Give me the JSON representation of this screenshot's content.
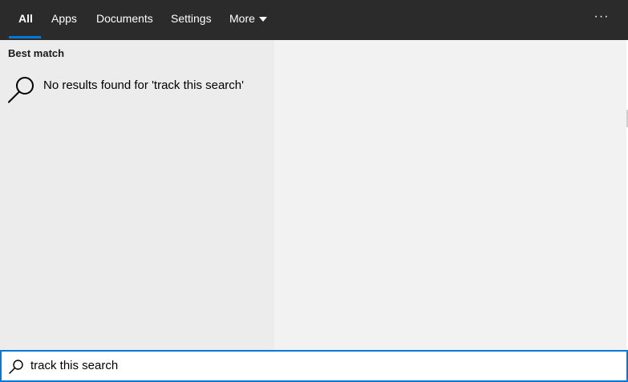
{
  "tabs": {
    "all": "All",
    "apps": "Apps",
    "documents": "Documents",
    "settings": "Settings",
    "more": "More"
  },
  "active_tab": "All",
  "overflow_menu": "···",
  "results": {
    "section_title": "Best match",
    "no_results_text": "No results found for 'track this search'",
    "icon": "search-icon"
  },
  "search": {
    "value": "track this search",
    "icon": "search-icon"
  },
  "colors": {
    "accent": "#0078d7",
    "topbar": "#2b2b2b",
    "left_pane": "#ececec",
    "right_pane": "#f2f2f2"
  }
}
